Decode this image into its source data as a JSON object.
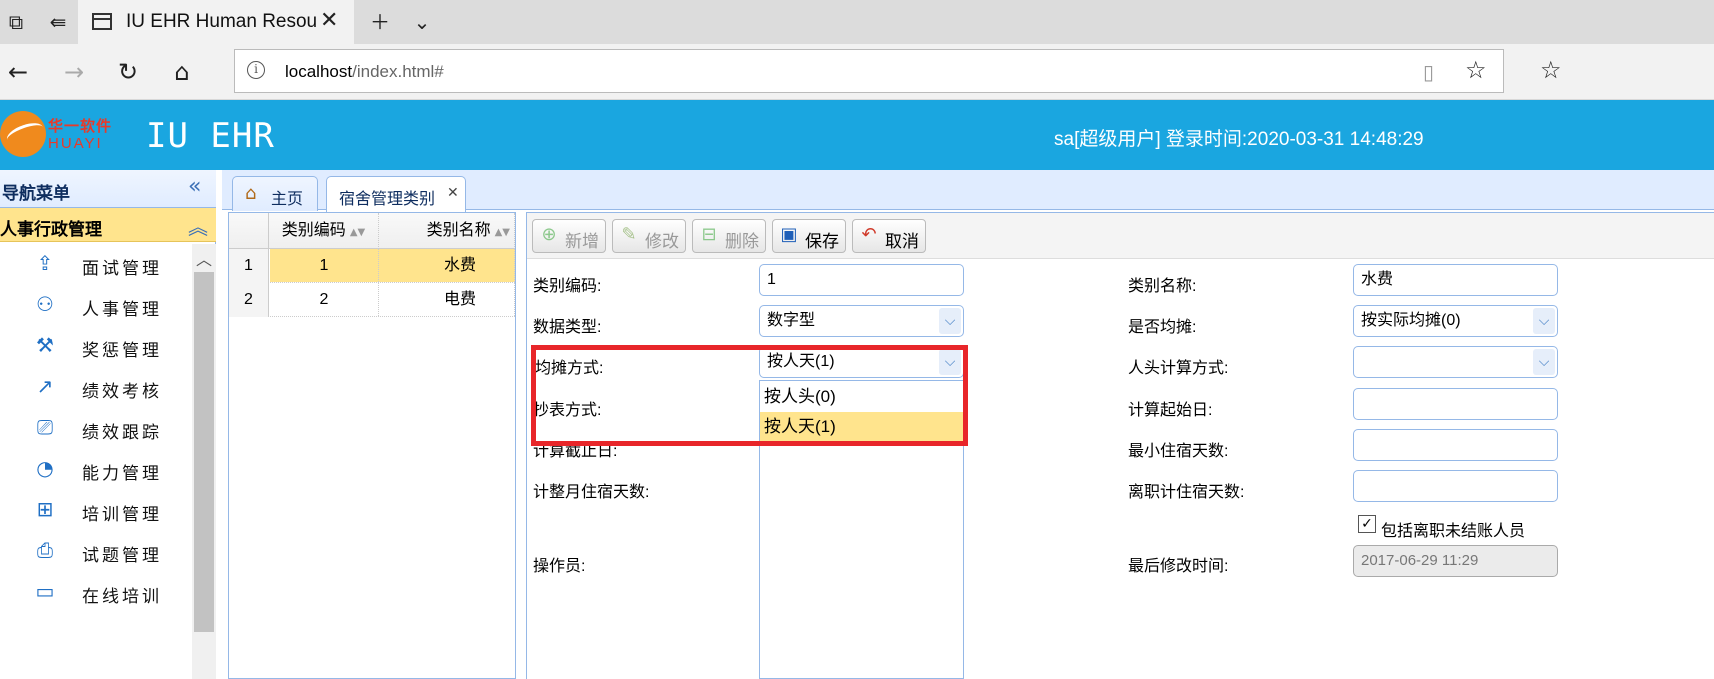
{
  "browser": {
    "tab_title": "IU EHR Human Resource",
    "url_host": "localhost",
    "url_path": "/index.html#"
  },
  "header": {
    "logo_cn": "华一软件",
    "logo_en": "HUAYI",
    "title": "IU EHR",
    "login_info": "sa[超级用户] 登录时间:2020-03-31 14:48:29"
  },
  "sidebar": {
    "title": "导航菜单",
    "group": "人事行政管理",
    "items": [
      {
        "label": "面试管理",
        "icon": "upload-icon"
      },
      {
        "label": "人事管理",
        "icon": "users-icon"
      },
      {
        "label": "奖惩管理",
        "icon": "hammer-icon"
      },
      {
        "label": "绩效考核",
        "icon": "chart-icon"
      },
      {
        "label": "绩效跟踪",
        "icon": "camera-icon"
      },
      {
        "label": "能力管理",
        "icon": "rss-icon"
      },
      {
        "label": "培训管理",
        "icon": "computer-icon"
      },
      {
        "label": "试题管理",
        "icon": "printer-icon"
      },
      {
        "label": "在线培训",
        "icon": "monitor-icon"
      }
    ]
  },
  "tabs": {
    "home": "主页",
    "active": "宿舍管理类别"
  },
  "grid": {
    "columns": [
      "类别编码",
      "类别名称"
    ],
    "rows": [
      {
        "num": "1",
        "code": "1",
        "name": "水费"
      },
      {
        "num": "2",
        "code": "2",
        "name": "电费"
      }
    ]
  },
  "toolbar": {
    "add": "新增",
    "edit": "修改",
    "delete": "删除",
    "save": "保存",
    "cancel": "取消"
  },
  "form": {
    "code_label": "类别编码:",
    "code_value": "1",
    "name_label": "类别名称:",
    "name_value": "水费",
    "datatype_label": "数据类型:",
    "datatype_value": "数字型",
    "share_label": "是否均摊:",
    "share_value": "按实际均摊(0)",
    "method_label": "均摊方式:",
    "method_value": "按人天(1)",
    "head_calc_label": "人头计算方式:",
    "meter_label": "抄表方式:",
    "start_day_label": "计算起始日:",
    "end_day_label": "计算截止日:",
    "min_days_label": "最小住宿天数:",
    "full_month_label": "计整月住宿天数:",
    "leave_days_label": "离职计住宿天数:",
    "include_label": "包括离职未结账人员",
    "operator_label": "操作员:",
    "modified_label": "最后修改时间:",
    "modified_value": "2017-06-29 11:29"
  },
  "dropdown": {
    "options": [
      "按人头(0)",
      "按人天(1)"
    ]
  },
  "colors": {
    "header": "#1aa6e0",
    "selected_row": "#ffe48d",
    "highlight": "#e8262a"
  }
}
